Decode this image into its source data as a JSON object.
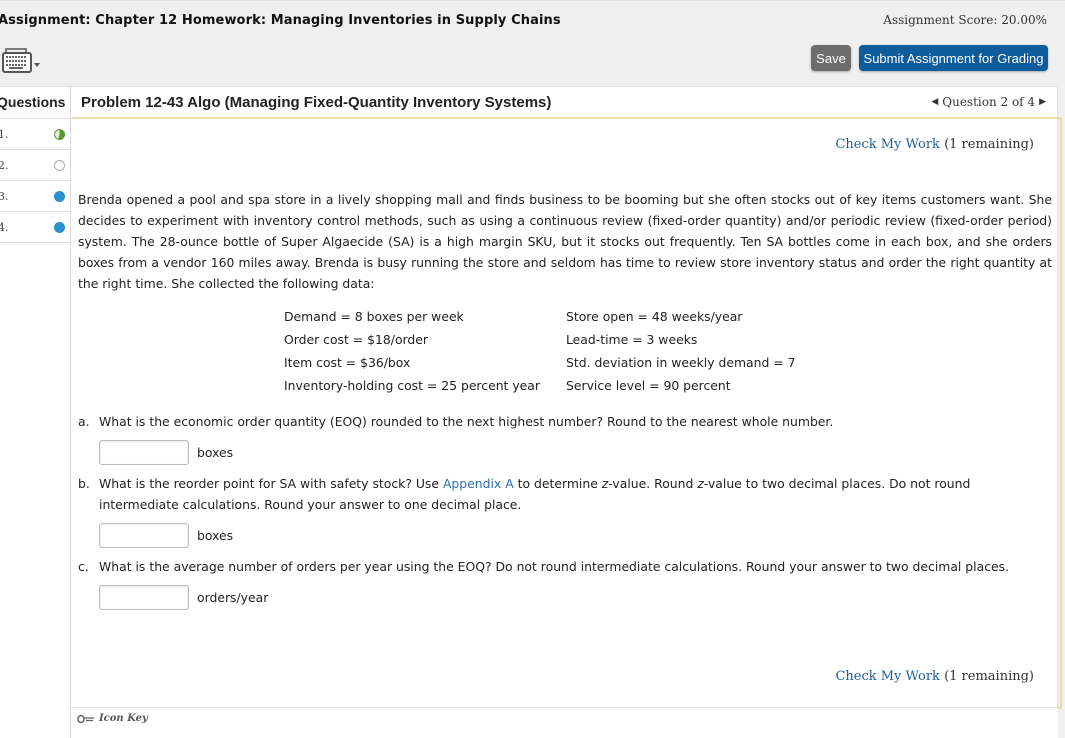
{
  "header": {
    "assignment_title": "Assignment: Chapter 12 Homework: Managing Inventories in Supply Chains",
    "assignment_score": "Assignment Score: 20.00%",
    "keyboard_icon": "keyboard-icon",
    "save_label": "Save",
    "submit_label": "Submit Assignment for Grading"
  },
  "questions_panel": {
    "heading": "Questions",
    "items": [
      {
        "label": "1.",
        "status": "partial",
        "color": "#5a9a2e"
      },
      {
        "label": "2.",
        "status": "not-started",
        "color": "#cccccc"
      },
      {
        "label": "3.",
        "status": "in-progress",
        "color": "#2a90d0"
      },
      {
        "label": "4.",
        "status": "in-progress",
        "color": "#2a90d0"
      }
    ]
  },
  "problem": {
    "title": "Problem 12-43 Algo (Managing Fixed-Quantity Inventory Systems)",
    "nav_label": "Question 2 of 4",
    "check_my_work": "Check My Work",
    "remaining": "(1 remaining)",
    "paragraph": "Brenda opened a pool and spa store in a lively shopping mall and finds business to be booming but she often stocks out of key items customers want. She decides to experiment with inventory control methods, such as using a continuous review (fixed-order quantity) and/or periodic review (fixed-order period) system. The 28-ounce bottle of Super Algaecide (SA) is a high margin SKU, but it stocks out frequently. Ten SA bottles come in each box, and she orders boxes from a vendor 160 miles away. Brenda is busy running the store and seldom has time to review store inventory status and order the right quantity at the right time. She collected the following data:",
    "data_left": [
      "Demand = 8 boxes per week",
      "Order cost = $18/order",
      "Item cost = $36/box",
      "Inventory-holding cost = 25 percent year"
    ],
    "data_right": [
      "Store open = 48 weeks/year",
      "Lead-time = 3 weeks",
      "Std. deviation in weekly demand = 7",
      "Service level = 90 percent"
    ],
    "questions": [
      {
        "letter": "a.",
        "text": "What is the economic order quantity (EOQ) rounded to the next highest number? Round to the nearest whole number.",
        "answer_value": "",
        "unit": "boxes"
      },
      {
        "letter": "b.",
        "text_before_link": "What is the reorder point for SA with safety stock? Use ",
        "link": "Appendix A",
        "text_after_link_1": " to determine ",
        "italic_z": "z",
        "text_after_link_2": "-value. Round ",
        "text_after_link_3": "-value to two decimal places. Do not round intermediate calculations. Round your answer to one decimal place.",
        "answer_value": "",
        "unit": "boxes"
      },
      {
        "letter": "c.",
        "text": "What is the average number of orders per year using the EOQ? Do not round intermediate calculations. Round your answer to two decimal places.",
        "answer_value": "",
        "unit": "orders/year"
      }
    ]
  },
  "footer": {
    "icon_key_label": "Icon Key"
  }
}
